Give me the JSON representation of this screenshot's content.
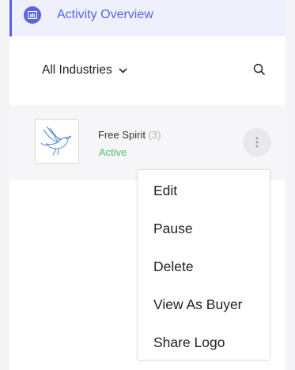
{
  "header": {
    "title": "Activity Overview",
    "icon": "chart-icon",
    "accent_color": "#5965e0"
  },
  "filter": {
    "label": "All Industries",
    "icon": "chevron-down-icon"
  },
  "search": {
    "icon": "search-icon"
  },
  "item": {
    "name": "Free Spirit",
    "count": "(3)",
    "status": "Active",
    "status_color": "#4fbf74",
    "logo": "bird-logo"
  },
  "menu": {
    "items": [
      "Edit",
      "Pause",
      "Delete",
      "View As Buyer",
      "Share Logo"
    ]
  }
}
